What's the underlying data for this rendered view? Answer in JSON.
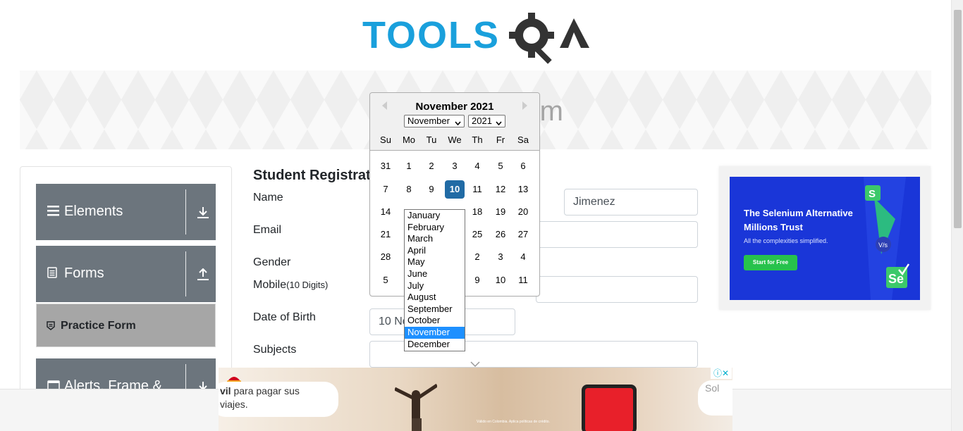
{
  "header": {
    "logo_text": "TOOLSQA"
  },
  "banner": {
    "title": "Practice Form",
    "visible_fragment": "rm"
  },
  "sidebar": {
    "groups": [
      {
        "label": "Elements",
        "icon": "menu-icon",
        "arrow": "download-arrow-icon"
      },
      {
        "label": "Forms",
        "icon": "document-icon",
        "arrow": "upload-arrow-icon"
      },
      {
        "label": "Alerts, Frame &",
        "icon": "window-icon",
        "arrow": "download-arrow-icon"
      }
    ],
    "active_item": {
      "label": "Practice Form",
      "icon": "doc-badge-icon"
    }
  },
  "form": {
    "title": "Student Registratio",
    "labels": {
      "name": "Name",
      "email": "Email",
      "gender": "Gender",
      "mobile": "Mobile",
      "mobile_hint": "(10 Digits)",
      "dob": "Date of Birth",
      "subjects": "Subjects"
    },
    "last_name_value": "Jimenez",
    "dob_value_visible": "10 No"
  },
  "datepicker": {
    "month_title": "November 2021",
    "month_select": "November",
    "year_select": "2021",
    "day_names": [
      "Su",
      "Mo",
      "Tu",
      "We",
      "Th",
      "Fr",
      "Sa"
    ],
    "weeks": [
      [
        "31",
        "1",
        "2",
        "3",
        "4",
        "5",
        "6"
      ],
      [
        "7",
        "8",
        "9",
        "10",
        "11",
        "12",
        "13"
      ],
      [
        "14",
        "",
        "",
        "",
        "18",
        "19",
        "20"
      ],
      [
        "21",
        "",
        "",
        "",
        "25",
        "26",
        "27"
      ],
      [
        "28",
        "",
        "",
        "",
        "2",
        "3",
        "4"
      ],
      [
        "5",
        "",
        "",
        "",
        "9",
        "10",
        "11"
      ]
    ],
    "selected_day": "10"
  },
  "month_dropdown": {
    "options": [
      "January",
      "February",
      "March",
      "April",
      "May",
      "June",
      "July",
      "August",
      "September",
      "October",
      "November",
      "December"
    ],
    "highlighted": "November"
  },
  "ad_right": {
    "headline_line1": "The Selenium Alternative",
    "headline_line2": "Millions Trust",
    "subtext": "All the complexities simplified.",
    "cta": "Start for Free"
  },
  "ad_bottom": {
    "text_bold": "vil",
    "text_rest": " para pagar sus",
    "text_line2": "viajes.",
    "text_right": "Sol",
    "fine_print": "Válido en Colombia. Aplica políticas de crédito."
  },
  "colors": {
    "sidebar_header": "#6c757d",
    "active_item": "#a6a6a6",
    "selected_day": "#216ba5",
    "dropdown_highlight": "#1e90ff",
    "logo_blue": "#1aa0dc",
    "logo_dark": "#333333"
  }
}
